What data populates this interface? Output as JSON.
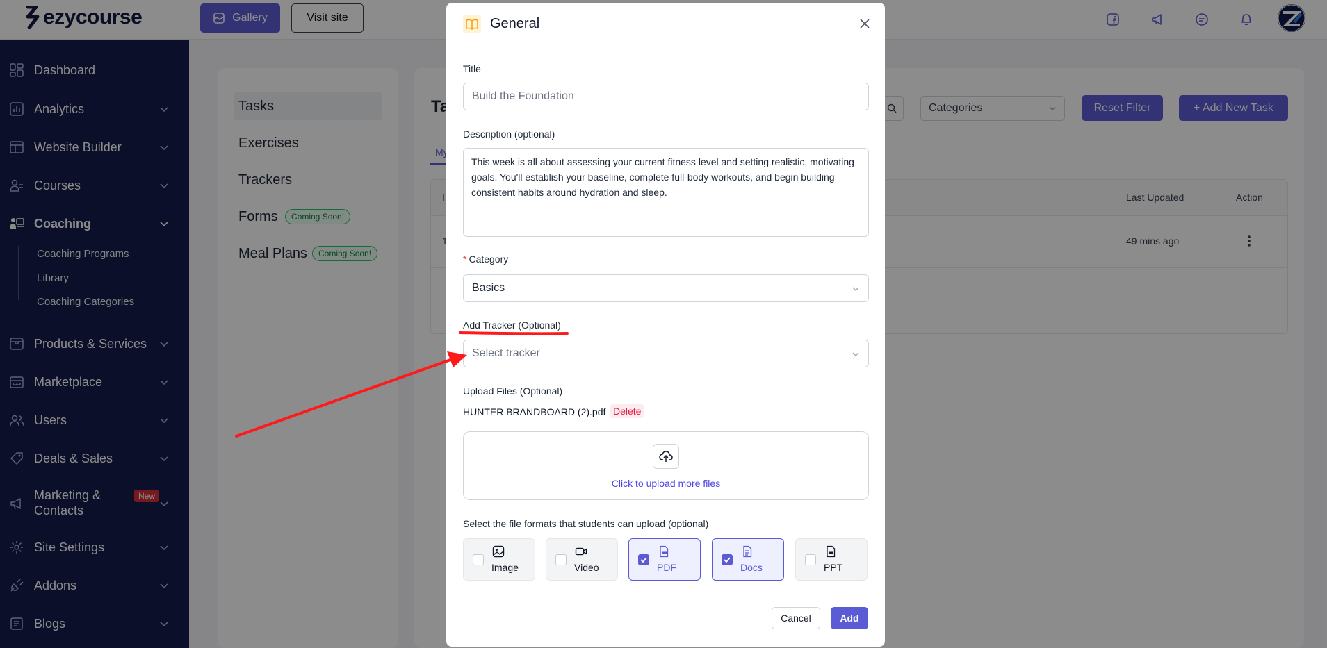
{
  "brand": {
    "name": "ezycourse"
  },
  "topbar": {
    "gallery_label": "Gallery",
    "visit_label": "Visit site",
    "icons": [
      "facebook-icon",
      "megaphone-icon",
      "chat-icon",
      "bell-icon"
    ]
  },
  "sidebar": {
    "items": [
      {
        "label": "Dashboard",
        "icon": "grid-icon"
      },
      {
        "label": "Analytics",
        "icon": "chart-icon"
      },
      {
        "label": "Website Builder",
        "icon": "layout-icon"
      },
      {
        "label": "Courses",
        "icon": "courses-icon"
      },
      {
        "label": "Coaching",
        "icon": "coaching-icon"
      },
      {
        "label": "Products & Services",
        "icon": "box-icon"
      },
      {
        "label": "Marketplace",
        "icon": "store-icon"
      },
      {
        "label": "Users",
        "icon": "users-icon"
      },
      {
        "label": "Deals & Sales",
        "icon": "tag-icon"
      },
      {
        "label": "Marketing & Contacts",
        "icon": "megaphone-icon"
      },
      {
        "label": "Site Settings",
        "icon": "gear-icon"
      },
      {
        "label": "Addons",
        "icon": "plug-icon"
      },
      {
        "label": "Blogs",
        "icon": "blog-icon"
      }
    ],
    "coaching_sub": [
      "Coaching Programs",
      "Library",
      "Coaching Categories"
    ],
    "marketing_line1": "Marketing &",
    "marketing_line2": "Contacts",
    "new_badge": "New"
  },
  "library_nav": {
    "items": [
      "Tasks",
      "Exercises",
      "Trackers",
      "Forms",
      "Meal Plans"
    ],
    "coming_soon": "Coming Soon!"
  },
  "main": {
    "title_fragment": "Ta",
    "tab_fragment": "My",
    "categories_select": "Categories",
    "reset_filter": "Reset Filter",
    "add_new_task": "+ Add New Task",
    "columns": {
      "first": "I",
      "last_updated": "Last Updated",
      "action": "Action"
    },
    "row": {
      "first": "1",
      "last_updated": "49 mins ago"
    }
  },
  "modal": {
    "title": "General",
    "title_label": "Title",
    "title_placeholder": "Build the Foundation",
    "description_label": "Description (optional)",
    "description_value": "This week is all about assessing your current fitness level and setting realistic, motivating goals. You'll establish your baseline, complete full-body workouts, and begin building consistent habits around hydration and sleep.",
    "category_required": "*",
    "category_label": "Category",
    "category_value": "Basics",
    "tracker_label": "Add Tracker (Optional)",
    "tracker_placeholder": "Select tracker",
    "upload_label": "Upload Files (Optional)",
    "file_name": "HUNTER BRANDBOARD (2).pdf",
    "delete_label": "Delete",
    "upload_more": "Click to upload more files",
    "formats_label": "Select the file formats that students can upload (optional)",
    "formats": [
      {
        "label": "Image",
        "checked": false,
        "icon": "image-icon"
      },
      {
        "label": "Video",
        "checked": false,
        "icon": "video-icon"
      },
      {
        "label": "PDF",
        "checked": true,
        "icon": "pdf-icon"
      },
      {
        "label": "Docs",
        "checked": true,
        "icon": "docs-icon"
      },
      {
        "label": "PPT",
        "checked": false,
        "icon": "ppt-icon"
      }
    ],
    "cancel": "Cancel",
    "add": "Add"
  },
  "colors": {
    "accent": "#5b5bd6",
    "sidebar": "#151d4b",
    "annotation": "#ff1a1a"
  }
}
